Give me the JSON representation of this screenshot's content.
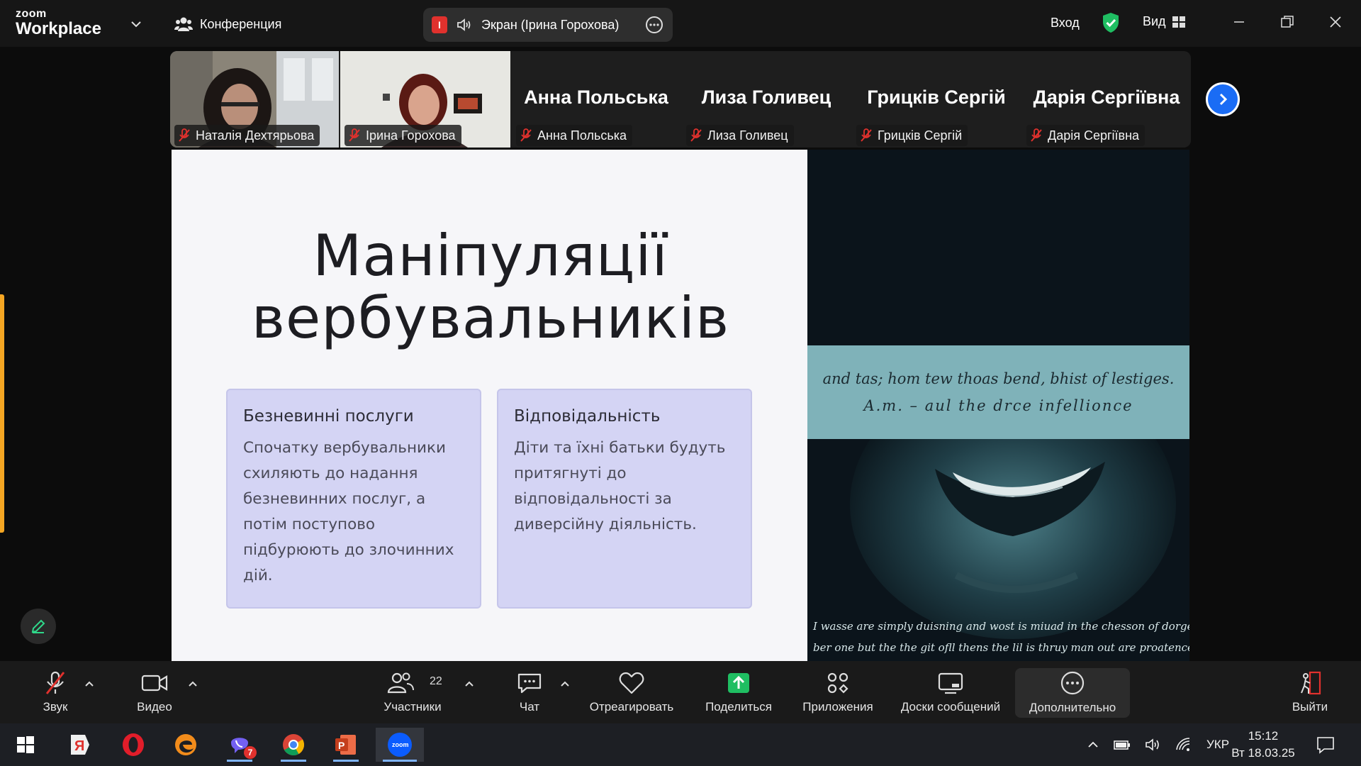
{
  "app": {
    "logo_top": "zoom",
    "logo_bottom": "Workplace"
  },
  "topbar": {
    "conference_label": "Конференция",
    "share_badge": "I",
    "share_label": "Экран (Ірина Горохова)",
    "login_label": "Вход",
    "view_label": "Вид"
  },
  "participants": [
    {
      "name": "Наталія Дехтярьова",
      "video": true,
      "active": false
    },
    {
      "name": "Ірина Горохова",
      "video": true,
      "active": true
    },
    {
      "name": "Анна Польська",
      "video": false,
      "active": false
    },
    {
      "name": "Лиза Голивец",
      "video": false,
      "active": false
    },
    {
      "name": "Грицків Сергій",
      "video": false,
      "active": false
    },
    {
      "name": "Дарія Сергіївна",
      "video": false,
      "active": false
    }
  ],
  "slide": {
    "title_line1": "Маніпуляції",
    "title_line2": "вербувальників",
    "cards": [
      {
        "heading": "Безневинні послуги",
        "lines": [
          "Спочатку вербувальники",
          "схиляють до надання",
          "безневинних послуг, а",
          "потім поступово",
          "підбурюють до злочинних",
          "дій."
        ]
      },
      {
        "heading": "Відповідальність",
        "lines": [
          "Діти та їхні батьки будуть",
          "притягнуті до",
          "відповідальності за",
          "диверсійну діяльність."
        ]
      }
    ],
    "image_quote_line1": "and tas; hom tew thoas bend, bhist of lestiges.",
    "image_quote_line2": "A.m. – aul the drce infellionce",
    "image_bottom_line1": "I wasse are simply duisning and wost is miuad in the chesson of dorgen.",
    "image_bottom_line2": "ber one but the the git ofll thens the lil is thruy man out are proatence."
  },
  "toolbar": {
    "audio_label": "Звук",
    "video_label": "Видео",
    "participants_label": "Участники",
    "participants_count": "22",
    "chat_label": "Чат",
    "react_label": "Отреагировать",
    "share_label": "Поделиться",
    "apps_label": "Приложения",
    "boards_label": "Доски сообщений",
    "more_label": "Дополнительно",
    "leave_label": "Выйти"
  },
  "taskbar": {
    "apps": [
      "windows-start",
      "yandex-browser",
      "opera",
      "edge",
      "viber",
      "chrome",
      "powerpoint",
      "zoom"
    ],
    "viber_badge": "7",
    "language": "УКР",
    "time": "15:12",
    "date": "Вт 18.03.25"
  },
  "colors": {
    "accent_green": "#2fd88a",
    "share_green": "#1fbe62",
    "next_blue": "#1a6cf5",
    "mic_red": "#e0312d",
    "card_bg": "#d4d4f4",
    "quote_band": "#7fb2b9"
  }
}
